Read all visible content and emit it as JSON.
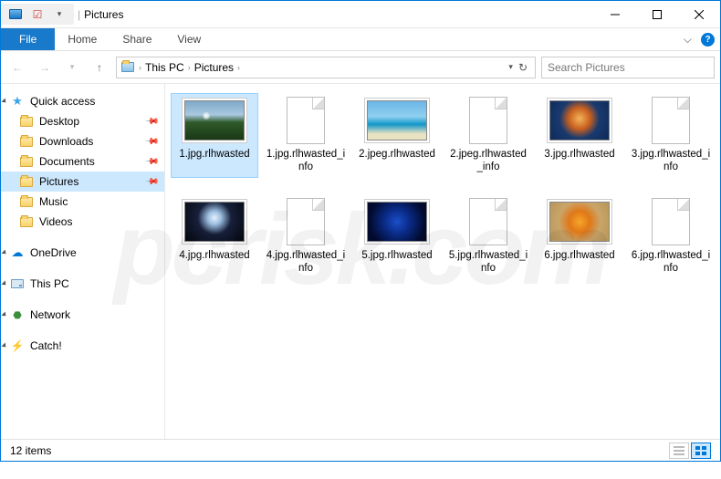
{
  "titlebar": {
    "title": "Pictures"
  },
  "ribbon": {
    "file": "File",
    "tabs": [
      "Home",
      "Share",
      "View"
    ]
  },
  "breadcrumb": {
    "items": [
      "This PC",
      "Pictures"
    ]
  },
  "search": {
    "placeholder": "Search Pictures"
  },
  "sidebar": {
    "quick_access": {
      "label": "Quick access",
      "items": [
        {
          "label": "Desktop",
          "pinned": true
        },
        {
          "label": "Downloads",
          "pinned": true
        },
        {
          "label": "Documents",
          "pinned": true
        },
        {
          "label": "Pictures",
          "pinned": true,
          "selected": true
        },
        {
          "label": "Music",
          "pinned": false
        },
        {
          "label": "Videos",
          "pinned": false
        }
      ]
    },
    "onedrive": {
      "label": "OneDrive"
    },
    "this_pc": {
      "label": "This PC"
    },
    "network": {
      "label": "Network"
    },
    "catch": {
      "label": "Catch!"
    }
  },
  "files": [
    {
      "name": "1.jpg.rlhwasted",
      "thumb": "t1",
      "image": true
    },
    {
      "name": "1.jpg.rlhwasted_info",
      "thumb": "",
      "image": false
    },
    {
      "name": "2.jpeg.rlhwasted",
      "thumb": "t2",
      "image": true
    },
    {
      "name": "2.jpeg.rlhwasted_info",
      "thumb": "",
      "image": false
    },
    {
      "name": "3.jpg.rlhwasted",
      "thumb": "t3",
      "image": true
    },
    {
      "name": "3.jpg.rlhwasted_info",
      "thumb": "",
      "image": false
    },
    {
      "name": "4.jpg.rlhwasted",
      "thumb": "t4",
      "image": true
    },
    {
      "name": "4.jpg.rlhwasted_info",
      "thumb": "",
      "image": false
    },
    {
      "name": "5.jpg.rlhwasted",
      "thumb": "t5",
      "image": true
    },
    {
      "name": "5.jpg.rlhwasted_info",
      "thumb": "",
      "image": false
    },
    {
      "name": "6.jpg.rlhwasted",
      "thumb": "t6",
      "image": true
    },
    {
      "name": "6.jpg.rlhwasted_info",
      "thumb": "",
      "image": false
    }
  ],
  "status": {
    "count": "12 items"
  }
}
